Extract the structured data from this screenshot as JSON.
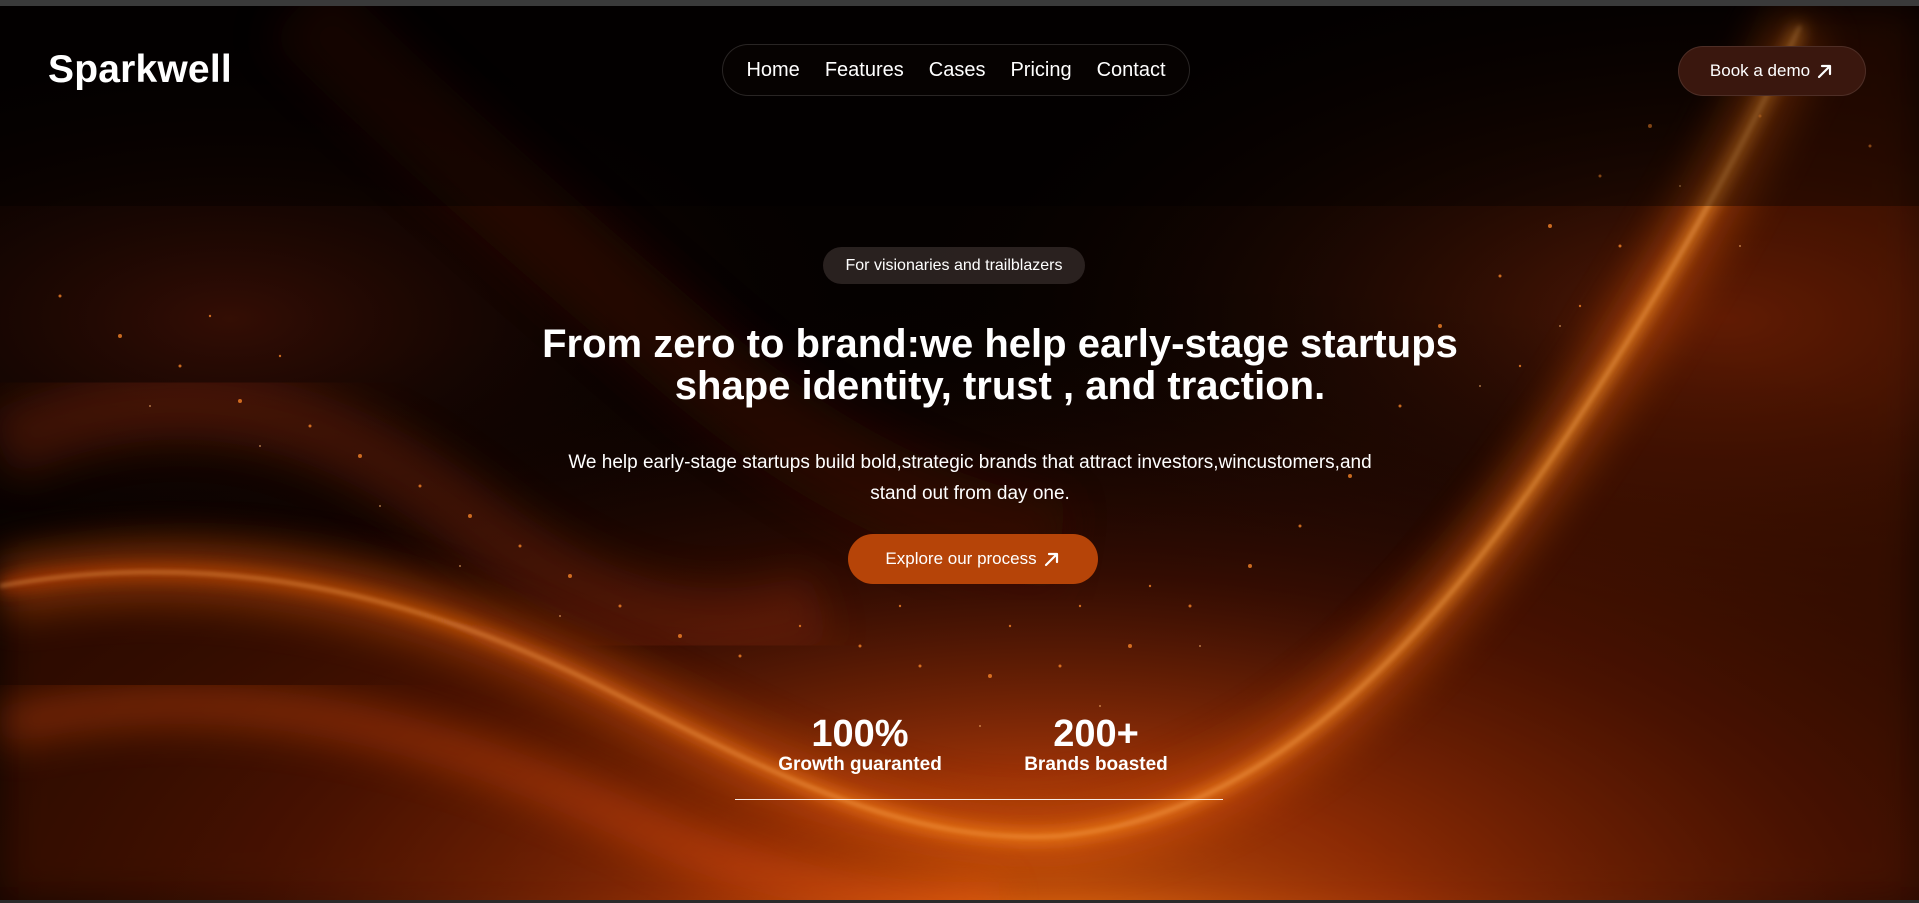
{
  "brand": {
    "name": "Sparkwell"
  },
  "nav": {
    "items": [
      {
        "label": "Home"
      },
      {
        "label": "Features"
      },
      {
        "label": "Cases"
      },
      {
        "label": "Pricing"
      },
      {
        "label": "Contact"
      }
    ]
  },
  "header": {
    "demo_label": "Book a demo",
    "demo_icon": "arrow-up-right-icon"
  },
  "hero": {
    "badge": "For visionaries and trailblazers",
    "headline_line1": "From zero to brand:we help early-stage startups",
    "headline_line2": "shape identity, trust , and traction.",
    "subtext_line1": "We help early-stage startups build bold,strategic brands that attract investors,wincustomers,and",
    "subtext_line2": "stand out from day one.",
    "cta_label": "Explore our process",
    "cta_icon": "arrow-up-right-icon"
  },
  "stats": [
    {
      "value": "100%",
      "label": "Growth guaranted"
    },
    {
      "value": "200+",
      "label": "Brands boasted"
    }
  ],
  "colors": {
    "accent": "#b64408",
    "background": "#000000",
    "glow": "#ff6a10"
  }
}
